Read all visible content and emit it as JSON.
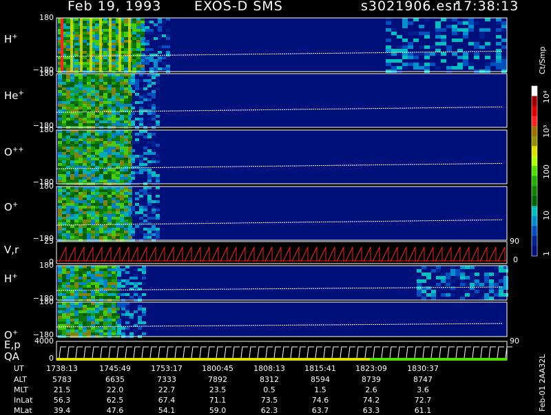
{
  "header": {
    "date": "Feb 19, 1993",
    "instrument": "EXOS-D SMS",
    "file": "s3021906.esr",
    "time": "17:38:13"
  },
  "panels": [
    {
      "label": "H",
      "sup": "+",
      "ymax": "180",
      "ymin": "−180"
    },
    {
      "label": "He",
      "sup": "+",
      "ymax": "180",
      "ymin": "−180"
    },
    {
      "label": "O",
      "sup": "++",
      "ymax": "180",
      "ymin": "−180"
    },
    {
      "label": "O",
      "sup": "+",
      "ymax": "180",
      "ymin": "−180"
    },
    {
      "label": "V,r",
      "sup": "",
      "ymax": "25",
      "ymin": "0",
      "right_top": "90",
      "right_bottom": "0"
    },
    {
      "label": "H",
      "sup": "+",
      "ymax": "180",
      "ymin": "−180"
    },
    {
      "label": "O",
      "sup": "+",
      "ymax": "180",
      "ymin": "−180"
    },
    {
      "label": "E,p",
      "sup": "",
      "ymax": "4000",
      "ymin": "0",
      "right_top": "90"
    }
  ],
  "qa_label": "QA",
  "colorbar": {
    "title": "Ct/Smp",
    "ticks": [
      "10⁴",
      "10³",
      "100",
      "10",
      "1"
    ],
    "colors": [
      "#ffffff",
      "#a00000",
      "#e00000",
      "#ff2020",
      "#a07000",
      "#909000",
      "#e0e000",
      "#b0ff00",
      "#50e000",
      "#20b000",
      "#108000",
      "#006800",
      "#00c0c0",
      "#0090d0",
      "#0050c0",
      "#002090",
      "#00107a"
    ]
  },
  "footer_code": "Feb-01 2AA32L",
  "table": {
    "rows": [
      {
        "name": "UT",
        "values": [
          "1738:13",
          "1745:49",
          "1753:17",
          "1800:45",
          "1808:13",
          "1815:41",
          "1823:09",
          "1830:37"
        ]
      },
      {
        "name": "ALT",
        "values": [
          "5783",
          "6635",
          "7333",
          "7892",
          "8312",
          "8594",
          "8739",
          "8747"
        ]
      },
      {
        "name": "MLT",
        "values": [
          "21.5",
          "22.0",
          "22.7",
          "23.5",
          "0.5",
          "1.5",
          "2.6",
          "3.6"
        ]
      },
      {
        "name": "InLat",
        "values": [
          "56.3",
          "62.5",
          "67.4",
          "71.1",
          "73.5",
          "74.6",
          "74.2",
          "72.7"
        ]
      },
      {
        "name": "MLat",
        "values": [
          "39.4",
          "47.6",
          "54.1",
          "59.0",
          "62.3",
          "63.7",
          "63.3",
          "61.1"
        ]
      }
    ]
  },
  "chart_data": {
    "type": "heatmap",
    "title": "Feb 19, 1993   EXOS-D SMS",
    "x_tick_labels": [
      "1738:13",
      "1745:49",
      "1753:17",
      "1800:45",
      "1808:13",
      "1815:41",
      "1823:09",
      "1830:37"
    ],
    "panels": [
      "H+",
      "He+",
      "O++",
      "O+",
      "V,r",
      "H+",
      "O+",
      "E,p"
    ],
    "y_ranges": [
      [
        -180,
        180
      ],
      [
        -180,
        180
      ],
      [
        -180,
        180
      ],
      [
        -180,
        180
      ],
      [
        0,
        25
      ],
      [
        -180,
        180
      ],
      [
        -180,
        180
      ],
      [
        0,
        4000
      ]
    ],
    "colorbar_range": [
      1,
      10000
    ],
    "colorbar_scale": "log",
    "units": "Ct/Smp"
  }
}
